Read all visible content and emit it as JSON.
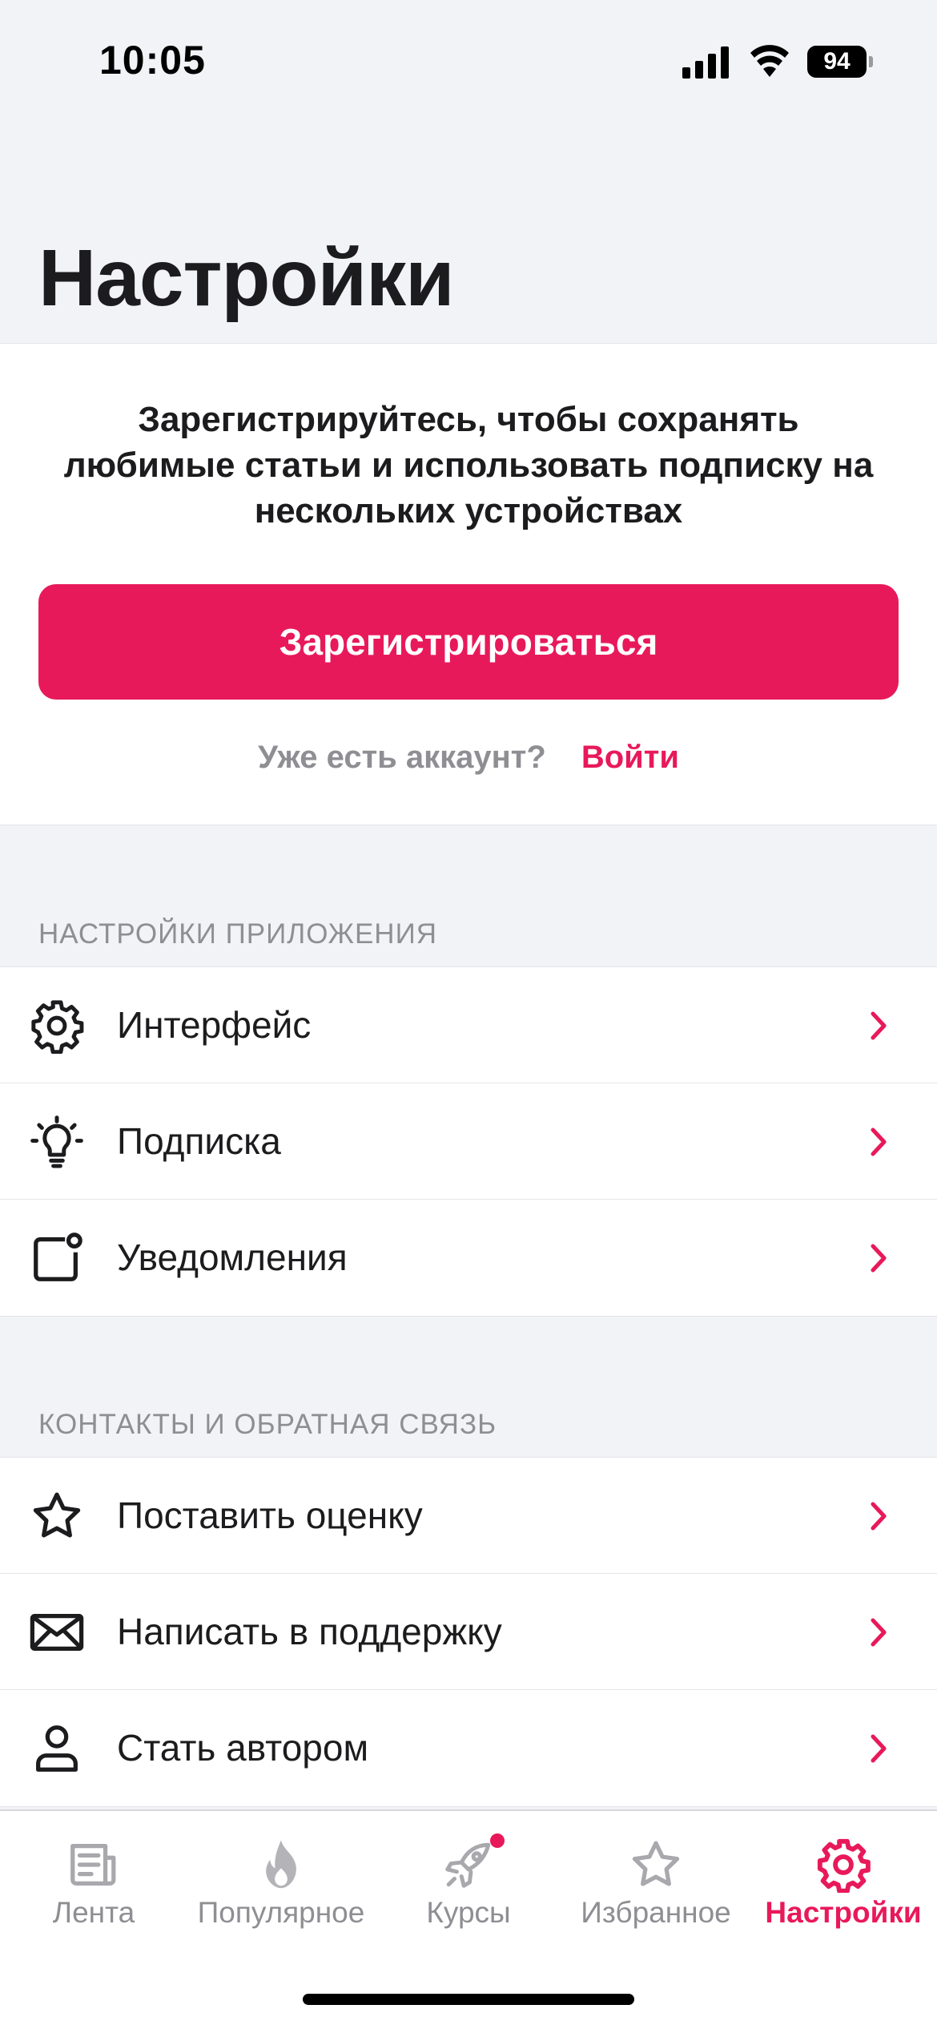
{
  "status_bar": {
    "time": "10:05",
    "battery_level": "94",
    "icons": [
      "cellular-signal-icon",
      "wifi-icon",
      "battery-icon"
    ]
  },
  "page": {
    "title": "Настройки"
  },
  "register": {
    "text": "Зарегистрируйтесь, чтобы сохранять любимые статьи и использовать подписку на нескольких устройствах",
    "button_label": "Зарегистрироваться",
    "login_question": "Уже есть аккаунт?",
    "login_link": "Войти"
  },
  "app_settings": {
    "header": "НАСТРОЙКИ ПРИЛОЖЕНИЯ",
    "items": [
      {
        "label": "Интерфейс",
        "icon": "gear-icon"
      },
      {
        "label": "Подписка",
        "icon": "lightbulb-icon"
      },
      {
        "label": "Уведомления",
        "icon": "notification-icon"
      }
    ]
  },
  "contacts": {
    "header": "КОНТАКТЫ И ОБРАТНАЯ СВЯЗЬ",
    "items": [
      {
        "label": "Поставить оценку",
        "icon": "star-icon"
      },
      {
        "label": "Написать в поддержку",
        "icon": "envelope-icon"
      },
      {
        "label": "Стать автором",
        "icon": "person-icon"
      }
    ]
  },
  "tab_bar": {
    "tabs": [
      {
        "label": "Лента",
        "icon": "newspaper-icon",
        "active": false
      },
      {
        "label": "Популярное",
        "icon": "flame-icon",
        "active": false
      },
      {
        "label": "Курсы",
        "icon": "rocket-icon",
        "active": false,
        "badge": true
      },
      {
        "label": "Избранное",
        "icon": "star-icon",
        "active": false
      },
      {
        "label": "Настройки",
        "icon": "gear-icon",
        "active": true
      }
    ]
  },
  "colors": {
    "accent": "#e8195a",
    "background": "#f2f3f7",
    "secondary_text": "#8e8e93"
  }
}
